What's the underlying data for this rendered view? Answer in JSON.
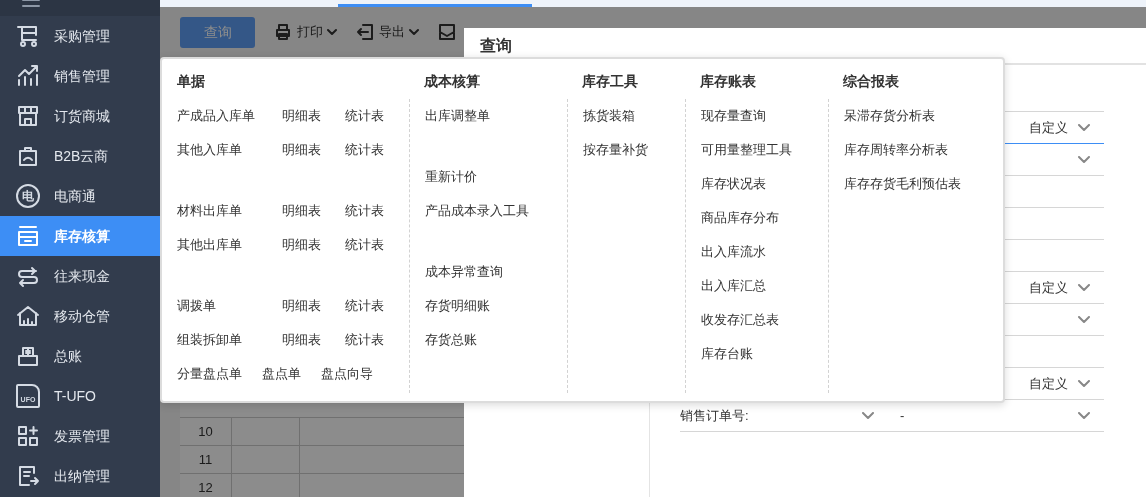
{
  "sidebar": {
    "items": [
      {
        "label": "采购管理",
        "selected": false
      },
      {
        "label": "销售管理",
        "selected": false
      },
      {
        "label": "订货商城",
        "selected": false
      },
      {
        "label": "B2B云商",
        "selected": false
      },
      {
        "label": "电商通",
        "selected": false,
        "icon_glyph": "电"
      },
      {
        "label": "库存核算",
        "selected": true
      },
      {
        "label": "往来现金",
        "selected": false
      },
      {
        "label": "移动仓管",
        "selected": false
      },
      {
        "label": "总账",
        "selected": false
      },
      {
        "label": "T-UFO",
        "selected": false,
        "icon_glyph": "UFO"
      },
      {
        "label": "发票管理",
        "selected": false
      },
      {
        "label": "出纳管理",
        "selected": false
      }
    ]
  },
  "toolbar": {
    "query_button": "查询",
    "menus": [
      {
        "label": "打印"
      },
      {
        "label": "导出"
      }
    ]
  },
  "grid": {
    "row_numbers": [
      "10",
      "11",
      "12"
    ]
  },
  "dialog": {
    "title": "查询",
    "rows": [
      {
        "kind": "blank",
        "focused": false
      },
      {
        "kind": "select",
        "value": "自定义",
        "focused": true
      },
      {
        "kind": "select",
        "focused": false
      },
      {
        "kind": "blank",
        "focused": false
      },
      {
        "kind": "blank",
        "focused": false
      },
      {
        "kind": "blank",
        "focused": false
      },
      {
        "kind": "select",
        "value": "自定义",
        "focused": false
      },
      {
        "kind": "select",
        "focused": false
      },
      {
        "kind": "blank",
        "focused": false
      },
      {
        "kind": "select",
        "value": "自定义",
        "focused": false
      },
      {
        "kind": "range",
        "label": "销售订单号:",
        "separator": "-",
        "focused": false
      }
    ]
  },
  "menu": {
    "columns": [
      {
        "title": "单据",
        "kind": "table",
        "groups": [
          [
            {
              "kind": "table",
              "links": [
                "产成品入库单",
                "明细表",
                "统计表"
              ]
            },
            {
              "kind": "table",
              "links": [
                "其他入库单",
                "明细表",
                "统计表"
              ]
            }
          ],
          [
            {
              "kind": "table",
              "links": [
                "材料出库单",
                "明细表",
                "统计表"
              ]
            },
            {
              "kind": "table",
              "links": [
                "其他出库单",
                "明细表",
                "统计表"
              ]
            }
          ],
          [
            {
              "kind": "table",
              "links": [
                "调拨单",
                "明细表",
                "统计表"
              ]
            },
            {
              "kind": "table",
              "links": [
                "组装拆卸单",
                "明细表",
                "统计表"
              ]
            },
            {
              "kind": "flow",
              "links": [
                "分量盘点单",
                "盘点单",
                "盘点向导"
              ]
            }
          ]
        ]
      },
      {
        "title": "成本核算",
        "kind": "list",
        "groups": [
          [
            "出库调整单"
          ],
          [
            "重新计价",
            "产品成本录入工具"
          ],
          [
            "成本异常查询",
            "存货明细账",
            "存货总账"
          ]
        ]
      },
      {
        "title": "库存工具",
        "kind": "list",
        "groups": [
          [
            "拣货装箱",
            "按存量补货"
          ]
        ]
      },
      {
        "title": "库存账表",
        "kind": "list",
        "groups": [
          [
            "现存量查询",
            "可用量整理工具",
            "库存状况表",
            "商品库存分布",
            "出入库流水",
            "出入库汇总",
            "收发存汇总表",
            "库存台账"
          ]
        ]
      },
      {
        "title": "综合报表",
        "kind": "list",
        "groups": [
          [
            "呆滞存货分析表",
            "库存周转率分析表",
            "库存存货毛利预估表"
          ]
        ]
      }
    ]
  }
}
